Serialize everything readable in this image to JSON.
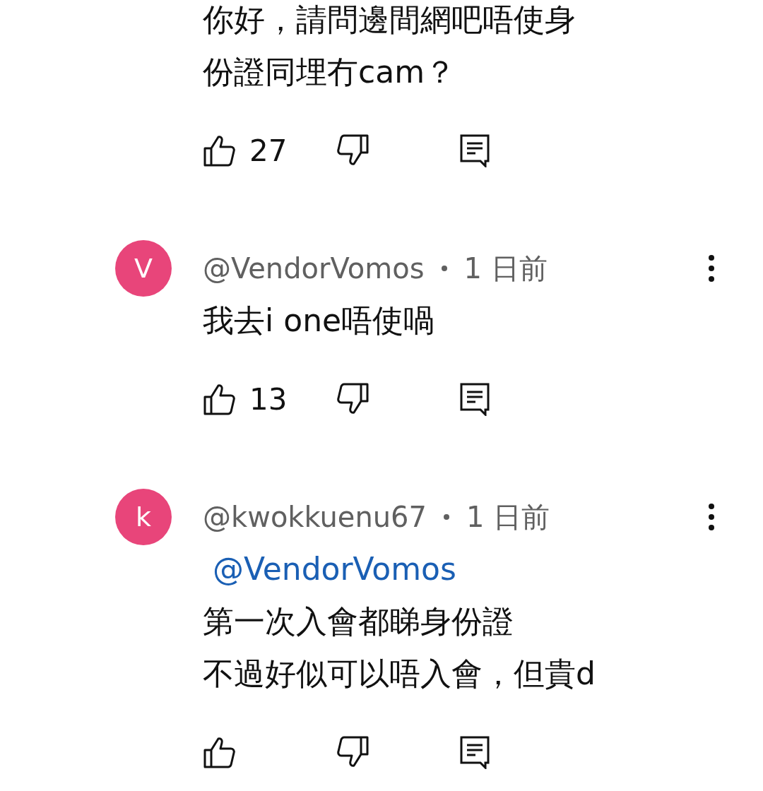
{
  "comments": [
    {
      "lines": [
        "你好，請問邊間網吧唔使身",
        "份證同埋冇cam？"
      ],
      "likes": "27"
    },
    {
      "avatar": {
        "letter": "V",
        "color": "#e8457a"
      },
      "author": "@VendorVomos",
      "time": "1 日前",
      "lines": [
        "我去i one唔使喎"
      ],
      "likes": "13"
    },
    {
      "avatar": {
        "letter": "k",
        "color": "#e8457a"
      },
      "author": "@kwokkuenu67",
      "time": "1 日前",
      "mention": "@VendorVomos",
      "lines": [
        "第一次入會都睇身份證",
        "不過好似可以唔入會，但貴d"
      ]
    }
  ]
}
